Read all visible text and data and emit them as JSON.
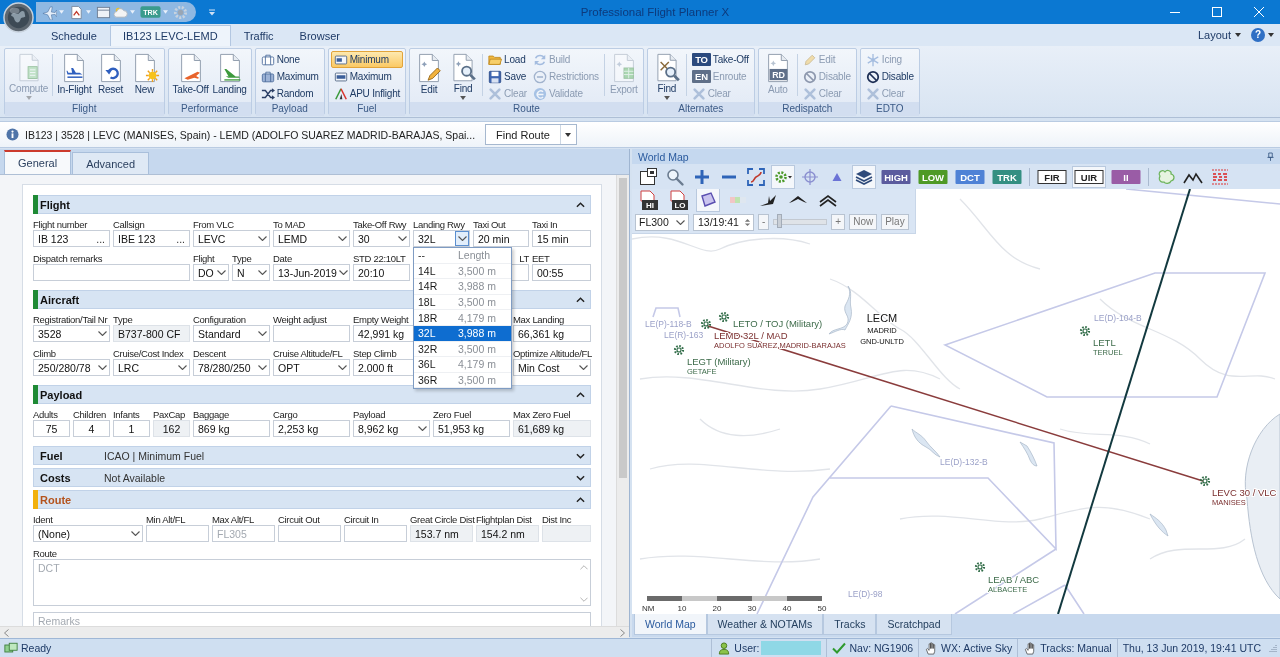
{
  "window": {
    "title": "Professional Flight Planner X"
  },
  "quick_access": [
    {
      "dropdown": true
    },
    {
      "dropdown": true
    },
    {
      "dropdown": false
    },
    {
      "dropdown": true
    },
    {
      "badge": "TRK",
      "dropdown": true
    },
    {
      "dropdown": false
    }
  ],
  "ribbon": {
    "tabs": [
      {
        "label": "Schedule",
        "selected": false
      },
      {
        "label": "IB123 LEVC-LEMD",
        "selected": true
      },
      {
        "label": "Traffic",
        "selected": false
      },
      {
        "label": "Browser",
        "selected": false
      }
    ],
    "layout_menu": "Layout",
    "help": "?",
    "groups": [
      {
        "label": "Flight",
        "items": [
          {
            "kind": "large",
            "label": "Compute",
            "disabled": true,
            "dropdown": true
          },
          {
            "kind": "separator"
          },
          {
            "kind": "large",
            "label": "In-Flight",
            "disabled": false,
            "dropdown": false
          },
          {
            "kind": "large",
            "label": "Reset",
            "disabled": false,
            "dropdown": false
          },
          {
            "kind": "large",
            "label": "New",
            "disabled": false,
            "dropdown": false
          }
        ]
      },
      {
        "label": "Performance",
        "items": [
          {
            "kind": "large",
            "label": "Take-Off",
            "disabled": false,
            "dropdown": false
          },
          {
            "kind": "large",
            "label": "Landing",
            "disabled": false,
            "dropdown": false
          }
        ]
      },
      {
        "label": "Payload",
        "items": [
          {
            "kind": "small",
            "label": "None",
            "disabled": false
          },
          {
            "kind": "small",
            "label": "Maximum",
            "disabled": false
          },
          {
            "kind": "small",
            "label": "Random",
            "disabled": false
          }
        ]
      },
      {
        "label": "Fuel",
        "items": [
          {
            "kind": "small",
            "label": "Minimum",
            "disabled": false,
            "selected": true
          },
          {
            "kind": "small",
            "label": "Maximum",
            "disabled": false,
            "selected": false
          },
          {
            "kind": "small",
            "label": "APU Inflight",
            "disabled": false,
            "selected": false
          }
        ]
      },
      {
        "label": "Route",
        "items": [
          {
            "kind": "large",
            "label": "Edit",
            "disabled": false,
            "dropdown": false
          },
          {
            "kind": "large",
            "label": "Find",
            "disabled": false,
            "dropdown": true
          },
          {
            "kind": "separator"
          },
          {
            "kind": "small",
            "label": "Load",
            "disabled": false
          },
          {
            "kind": "small",
            "label": "Save",
            "disabled": false
          },
          {
            "kind": "small",
            "label": "Clear",
            "disabled": true
          },
          {
            "kind": "small",
            "label": "Build",
            "disabled": true
          },
          {
            "kind": "small",
            "label": "Restrictions",
            "disabled": true
          },
          {
            "kind": "small",
            "label": "Validate",
            "disabled": true
          },
          {
            "kind": "separator"
          },
          {
            "kind": "large",
            "label": "Export",
            "disabled": true,
            "dropdown": false
          }
        ]
      },
      {
        "label": "Alternates",
        "items": [
          {
            "kind": "large",
            "label": "Find",
            "disabled": false,
            "dropdown": true
          },
          {
            "kind": "separator"
          },
          {
            "kind": "small",
            "label": "Take-Off",
            "disabled": false,
            "badge": "TO"
          },
          {
            "kind": "small",
            "label": "Enroute",
            "disabled": true,
            "badge": "EN"
          },
          {
            "kind": "small",
            "label": "Clear",
            "disabled": true
          }
        ]
      },
      {
        "label": "Redispatch",
        "items": [
          {
            "kind": "large",
            "label": "Auto",
            "disabled": true,
            "dropdown": false,
            "badge": "RD"
          },
          {
            "kind": "separator"
          },
          {
            "kind": "small",
            "label": "Edit",
            "disabled": true
          },
          {
            "kind": "small",
            "label": "Disable",
            "disabled": true
          },
          {
            "kind": "small",
            "label": "Clear",
            "disabled": true
          }
        ]
      },
      {
        "label": "EDTO",
        "items": [
          {
            "kind": "small",
            "label": "Icing",
            "disabled": true
          },
          {
            "kind": "small",
            "label": "Disable",
            "disabled": false
          },
          {
            "kind": "small",
            "label": "Clear",
            "disabled": true
          }
        ]
      }
    ]
  },
  "info_bar": {
    "text": "IB123 | 3528 | LEVC (MANISES, Spain) - LEMD (ADOLFO SUAREZ MADRID-BARAJAS, Spai...",
    "button": "Find Route"
  },
  "form": {
    "tabs": [
      {
        "label": "General",
        "selected": true
      },
      {
        "label": "Advanced",
        "selected": false
      }
    ],
    "sections": [
      {
        "title": "Flight",
        "color": "#1f8a35",
        "warning": false,
        "expanded": true,
        "fields": [
          {
            "label": "Flight number",
            "value": "IB 123",
            "kind": "lookup",
            "button": "..."
          },
          {
            "label": "Callsign",
            "value": "IBE 123",
            "kind": "lookup",
            "button": "..."
          },
          {
            "label": "From VLC",
            "value": "LEVC",
            "kind": "combo"
          },
          {
            "label": "To MAD",
            "value": "LEMD",
            "kind": "combo"
          },
          {
            "label": "Take-Off Rwy",
            "value": "30",
            "kind": "combo"
          },
          {
            "label": "Landing Rwy",
            "value": "32L",
            "kind": "combo",
            "open": true,
            "list_header": [
              "--",
              "Length"
            ],
            "options": [
              {
                "runway": "14L",
                "length": "3,500 m",
                "selected": false
              },
              {
                "runway": "14R",
                "length": "3,988 m",
                "selected": false
              },
              {
                "runway": "18L",
                "length": "3,500 m",
                "selected": false
              },
              {
                "runway": "18R",
                "length": "4,179 m",
                "selected": false
              },
              {
                "runway": "32L",
                "length": "3,988 m",
                "selected": true
              },
              {
                "runway": "32R",
                "length": "3,500 m",
                "selected": false
              },
              {
                "runway": "36L",
                "length": "4,179 m",
                "selected": false
              },
              {
                "runway": "36R",
                "length": "3,500 m",
                "selected": false
              }
            ]
          },
          {
            "label": "Taxi Out",
            "value": "20 min",
            "kind": "text"
          },
          {
            "label": "Taxi In",
            "value": "15 min",
            "kind": "text"
          },
          {
            "label": "Dispatch remarks",
            "kind": "text"
          },
          {
            "label": "Flight",
            "value": "DO",
            "kind": "combo"
          },
          {
            "label": "Type",
            "value": "N",
            "kind": "combo"
          },
          {
            "label": "Date",
            "value": "13-Jun-2019",
            "kind": "combo"
          },
          {
            "label": "STD 22:10LT",
            "value": "20:10",
            "kind": "text"
          },
          {
            "kind": "covered"
          },
          {
            "label": "LT",
            "kind": "covered"
          },
          {
            "label": "EET",
            "value": "00:55",
            "kind": "text"
          }
        ]
      },
      {
        "title": "Aircraft",
        "color": "#1f8a35",
        "warning": false,
        "expanded": true,
        "fields": [
          {
            "label": "Registration/Tail Nr",
            "value": "3528",
            "kind": "combo"
          },
          {
            "label": "Type",
            "value": "B737-800 CF",
            "kind": "display"
          },
          {
            "label": "Configuration",
            "value": "Standard",
            "kind": "combo"
          },
          {
            "label": "Weight adjust",
            "kind": "text"
          },
          {
            "label": "Empty Weight",
            "value": "42,991 kg",
            "kind": "text"
          },
          {
            "kind": "covered"
          },
          {
            "label": "Max Landing",
            "value": "66,361 kg",
            "kind": "text"
          },
          {
            "label": "Climb",
            "value": "250/280/78",
            "kind": "combo"
          },
          {
            "label": "Cruise/Cost Index",
            "value": "LRC",
            "kind": "combo"
          },
          {
            "label": "Descent",
            "value": "78/280/250",
            "kind": "combo"
          },
          {
            "label": "Cruise Altitude/FL",
            "value": "OPT",
            "kind": "combo"
          },
          {
            "label": "Step Climb",
            "value": "2.000 ft",
            "kind": "text"
          },
          {
            "kind": "covered"
          },
          {
            "label": "Optimize Altitude/FL",
            "value": "Min Cost",
            "kind": "combo"
          }
        ]
      },
      {
        "title": "Payload",
        "color": "#1f8a35",
        "warning": false,
        "expanded": true,
        "fields": [
          {
            "label": "Adults",
            "value": "75",
            "kind": "count"
          },
          {
            "label": "Children",
            "value": "4",
            "kind": "count"
          },
          {
            "label": "Infants",
            "value": "1",
            "kind": "count"
          },
          {
            "label": "PaxCap",
            "value": "162",
            "kind": "count-display"
          },
          {
            "label": "Baggage",
            "value": "869 kg",
            "kind": "text"
          },
          {
            "label": "Cargo",
            "value": "2,253 kg",
            "kind": "text"
          },
          {
            "label": "Payload",
            "value": "8,962 kg",
            "kind": "combo"
          },
          {
            "label": "Zero Fuel",
            "value": "51,953 kg",
            "kind": "text"
          },
          {
            "label": "Max Zero Fuel",
            "value": "61,689 kg",
            "kind": "display"
          }
        ]
      },
      {
        "title": "Fuel",
        "warning": false,
        "expanded": false,
        "summary": "ICAO | Minimum Fuel"
      },
      {
        "title": "Costs",
        "warning": false,
        "expanded": false,
        "summary": "Not Available"
      },
      {
        "title": "Route",
        "color": "#f2b10d",
        "warning": true,
        "expanded": true,
        "fields": [
          {
            "label": "Ident",
            "value": "(None)",
            "kind": "combo"
          },
          {
            "label": "Min Alt/FL",
            "kind": "text"
          },
          {
            "label": "Max Alt/FL",
            "placeholder": "FL305",
            "kind": "text"
          },
          {
            "label": "Circuit Out",
            "kind": "text"
          },
          {
            "label": "Circuit In",
            "kind": "text"
          },
          {
            "label": "Great Circle Dist",
            "value": "153.7 nm",
            "kind": "display"
          },
          {
            "label": "Flightplan Dist",
            "value": "154.2 nm",
            "kind": "display"
          },
          {
            "label": "Dist Inc",
            "kind": "display"
          },
          {
            "label": "Route",
            "placeholder": "DCT",
            "kind": "note"
          },
          {
            "placeholder": "Remarks",
            "kind": "text"
          }
        ]
      }
    ]
  },
  "map": {
    "title": "World Map",
    "toolbar": [
      {
        "kind": "icon",
        "selected": false
      },
      {
        "kind": "icon",
        "selected": false
      },
      {
        "kind": "icon",
        "selected": false
      },
      {
        "kind": "icon",
        "selected": false
      },
      {
        "kind": "icon",
        "selected": false
      },
      {
        "kind": "icon",
        "selected": true
      },
      {
        "kind": "icon",
        "selected": false
      },
      {
        "kind": "icon",
        "selected": false
      },
      {
        "kind": "icon",
        "selected": true
      },
      {
        "kind": "badge",
        "label": "HIGH",
        "color": "#5b5b9e",
        "selected": false
      },
      {
        "kind": "badge",
        "label": "LOW",
        "color": "#4f9a26",
        "selected": false
      },
      {
        "kind": "badge",
        "label": "DCT",
        "color": "#4f82d6",
        "selected": false
      },
      {
        "kind": "badge",
        "label": "TRK",
        "color": "#348f82",
        "selected": false
      },
      {
        "kind": "outline",
        "label": "FIR",
        "selected": false
      },
      {
        "kind": "outline",
        "label": "UIR",
        "selected": true
      },
      {
        "kind": "badge",
        "label": "II",
        "color": "#9a5ca6",
        "selected": false
      },
      {
        "kind": "icon",
        "selected": false
      },
      {
        "kind": "icon",
        "selected": false
      },
      {
        "kind": "icon",
        "selected": false
      }
    ],
    "overlay_toolbar": [
      {
        "kind": "chart",
        "label": "HI",
        "selected": false
      },
      {
        "kind": "chart",
        "label": "LO",
        "selected": false
      },
      {
        "kind": "icon",
        "selected": true
      },
      {
        "kind": "icon",
        "selected": false
      },
      {
        "kind": "icon",
        "selected": false
      },
      {
        "kind": "icon",
        "selected": false
      },
      {
        "kind": "icon",
        "selected": false
      }
    ],
    "flight_level_select": "FL300",
    "time": "13/19:41",
    "step_back": "-",
    "step_forward": "+",
    "time_slider": {
      "level": 0.05
    },
    "now_button": "Now",
    "play_button": "Play",
    "airports": [
      {
        "ident": "LETO / TOJ (Military)",
        "kind": "field"
      },
      {
        "ident": "LEMD 32L / MAD",
        "name": "ADOLFO SUAREZ MADRID-BARAJAS",
        "kind": "route"
      },
      {
        "ident": "LECM",
        "name": "MADRID",
        "note": "GND-UNLTD",
        "kind": "sector"
      },
      {
        "ident": "LEGT (Military)",
        "name": "GETAFE",
        "kind": "field"
      },
      {
        "ident": "LETL",
        "name": "TERUEL",
        "kind": "field"
      },
      {
        "ident": "LEVC 30 / VLC",
        "name": "MANISES",
        "kind": "route"
      },
      {
        "ident": "LEAB / ABC",
        "name": "ALBACETE",
        "kind": "field"
      }
    ],
    "airspaces": [
      "LE(P)-118-B",
      "LE(R)-163",
      "LE(D)-104-B",
      "LE(D)-132-B",
      "LE(D)-98"
    ],
    "scale": {
      "unit": "NM",
      "ticks": [
        "10",
        "20",
        "30",
        "40",
        "50"
      ]
    },
    "tabs": [
      {
        "label": "World Map",
        "selected": true
      },
      {
        "label": "Weather & NOTAMs",
        "selected": false
      },
      {
        "label": "Tracks",
        "selected": false
      },
      {
        "label": "Scratchpad",
        "selected": false
      }
    ]
  },
  "status_bar": {
    "text": "Ready",
    "user": "User:",
    "nav": "Nav: NG1906",
    "weather": "WX: Active Sky",
    "tracks": "Tracks: Manual",
    "clock": "Thu, 13 Jun 2019, 19:41 UTC"
  }
}
